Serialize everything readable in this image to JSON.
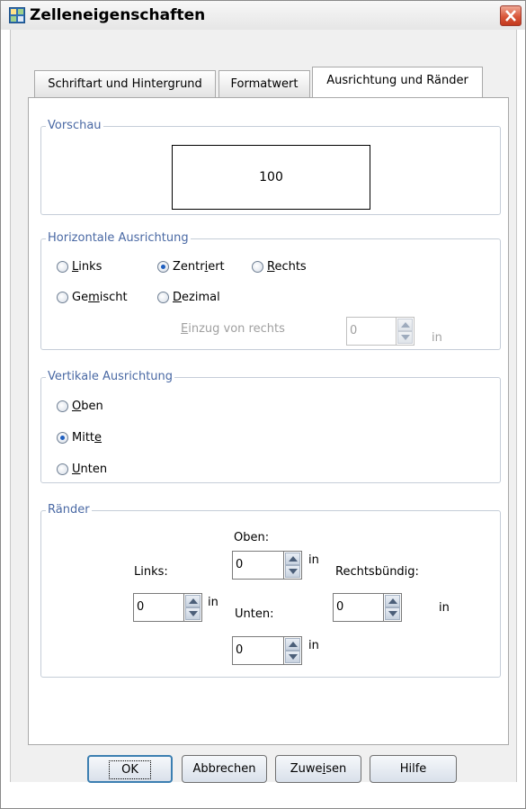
{
  "window": {
    "title": "Zelleneigenschaften"
  },
  "tabs": [
    {
      "label": "Schriftart und Hintergrund",
      "active": false
    },
    {
      "label": "Formatwert",
      "active": false
    },
    {
      "label": "Ausrichtung und Ränder",
      "active": true
    }
  ],
  "preview": {
    "legend": "Vorschau",
    "value": "100"
  },
  "horizontal": {
    "legend": "Horizontale Ausrichtung",
    "options": [
      {
        "pre": "",
        "key": "L",
        "post": "inks",
        "checked": false
      },
      {
        "pre": "Zentr",
        "key": "i",
        "post": "ert",
        "checked": true
      },
      {
        "pre": "",
        "key": "R",
        "post": "echts",
        "checked": false
      },
      {
        "pre": "Ge",
        "key": "m",
        "post": "ischt",
        "checked": false
      },
      {
        "pre": "",
        "key": "D",
        "post": "ezimal",
        "checked": false
      }
    ],
    "indent": {
      "pre": "",
      "key": "E",
      "post": "inzug von rechts",
      "value": "0",
      "unit": "in"
    }
  },
  "vertical": {
    "legend": "Vertikale Ausrichtung",
    "options": [
      {
        "pre": "",
        "key": "O",
        "post": "ben",
        "checked": false
      },
      {
        "pre": "Mitt",
        "key": "e",
        "post": "",
        "checked": true
      },
      {
        "pre": "",
        "key": "U",
        "post": "nten",
        "checked": false
      }
    ]
  },
  "margins": {
    "legend": "Ränder",
    "top": {
      "label": "Oben:",
      "value": "0",
      "unit": "in"
    },
    "left": {
      "label": "Links:",
      "value": "0",
      "unit": "in"
    },
    "bottom": {
      "label": "Unten:",
      "value": "0",
      "unit": "in"
    },
    "right": {
      "label": "Rechtsbündig:",
      "value": "0",
      "unit": "in"
    }
  },
  "buttons": {
    "ok": "OK",
    "cancel": "Abbrechen",
    "apply_pre": "Zuwe",
    "apply_key": "i",
    "apply_post": "sen",
    "help": "Hilfe"
  },
  "colors": {
    "legend_text": "#4a69a4",
    "default_button_border": "#3c7fb1",
    "close_button": "#d9573a"
  }
}
